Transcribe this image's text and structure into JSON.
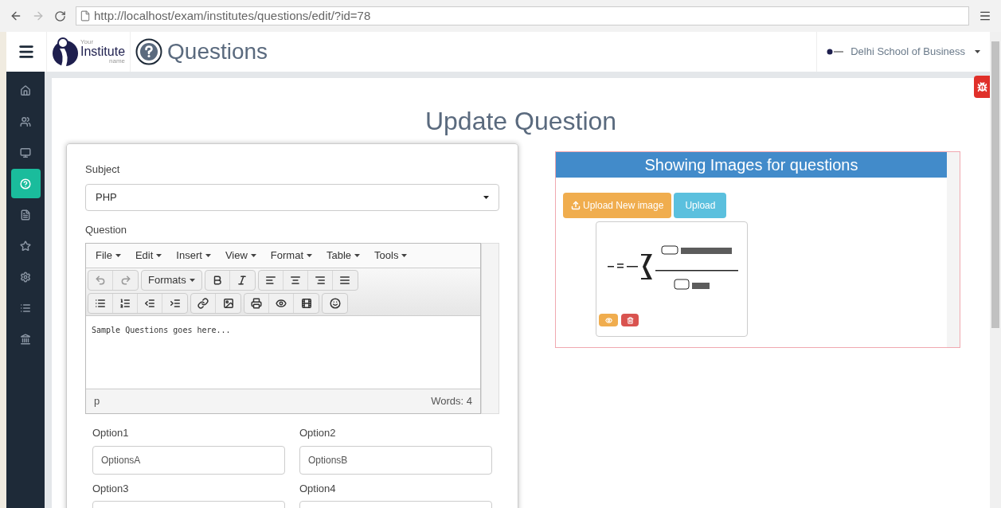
{
  "browser": {
    "url": "http://localhost/exam/institutes/questions/edit/?id=78"
  },
  "header": {
    "logo": {
      "small_top": "Your",
      "main": "Institute",
      "small_bottom": "name"
    },
    "title": "Questions",
    "institute": "Delhi School of Business"
  },
  "sidebar": {
    "items": [
      {
        "kind": "home",
        "selected": false
      },
      {
        "kind": "users",
        "selected": false
      },
      {
        "kind": "monitor",
        "selected": false
      },
      {
        "kind": "question",
        "selected": true
      },
      {
        "kind": "file",
        "selected": false
      },
      {
        "kind": "star",
        "selected": false
      },
      {
        "kind": "gear",
        "selected": false
      },
      {
        "kind": "list",
        "selected": false
      },
      {
        "kind": "bank",
        "selected": false
      }
    ]
  },
  "page_title": "Update Question",
  "form": {
    "subject": {
      "label": "Subject",
      "value": "PHP"
    },
    "question": {
      "label": "Question",
      "menu": [
        "File",
        "Edit",
        "Insert",
        "View",
        "Format",
        "Table",
        "Tools"
      ],
      "formats": "Formats",
      "content": "Sample Questions goes here...",
      "path": "p",
      "word_count": "Words: 4"
    },
    "options": [
      {
        "label": "Option1",
        "value": "OptionsA"
      },
      {
        "label": "Option2",
        "value": "OptionsB"
      },
      {
        "label": "Option3"
      },
      {
        "label": "Option4"
      }
    ]
  },
  "images_panel": {
    "title": "Showing Images for questions",
    "upload_new": "Upload New image",
    "upload": "Upload"
  }
}
